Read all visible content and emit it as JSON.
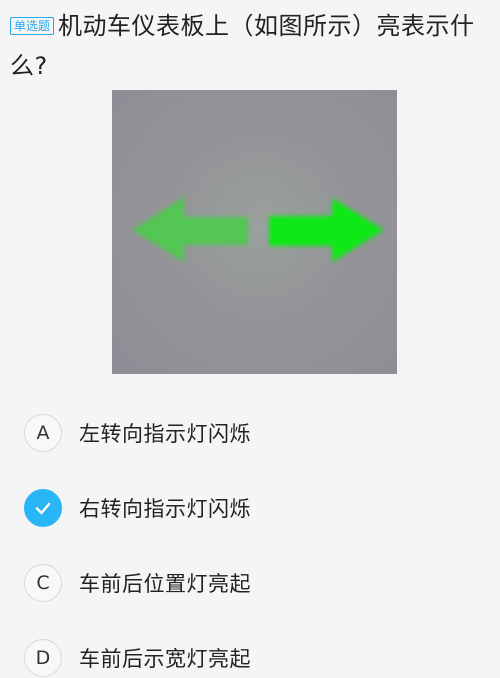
{
  "question": {
    "type_badge": "单选题",
    "text": "机动车仪表板上（如图所示）亮表示什么?"
  },
  "figure": {
    "icon": "turn-signal-arrows-icon",
    "left_arrow_color": "#52c653",
    "right_arrow_color": "#0ee813"
  },
  "options": [
    {
      "letter": "A",
      "text": "左转向指示灯闪烁",
      "selected": false
    },
    {
      "letter": "B",
      "text": "右转向指示灯闪烁",
      "selected": true,
      "icon": "checkmark-icon"
    },
    {
      "letter": "C",
      "text": "车前后位置灯亮起",
      "selected": false
    },
    {
      "letter": "D",
      "text": "车前后示宽灯亮起",
      "selected": false
    }
  ],
  "colors": {
    "accent": "#29b6f6",
    "badge": "#29a8e8",
    "background": "#f5f5f5"
  }
}
